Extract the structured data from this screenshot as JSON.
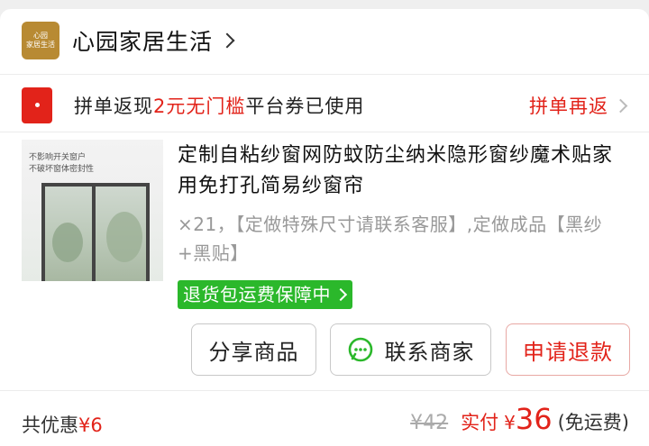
{
  "store": {
    "logo_line1": "心园",
    "logo_line2": "家居生活",
    "name": "心园家居生活"
  },
  "coupon": {
    "prefix": "拼单返现",
    "highlight": "2元无门槛",
    "suffix": "平台券已使用",
    "action": "拼单再返"
  },
  "product": {
    "thumb_caption_1": "不影响开关窗户",
    "thumb_caption_2": "不破坏窗体密封性",
    "title": "定制自粘纱窗网防蚊防尘纳米隐形窗纱魔术贴家用免打孔简易纱窗帘",
    "spec": "×21，【定做特殊尺寸请联系客服】,定做成品【黑纱+黑贴】",
    "tag": "退货包运费保障中"
  },
  "actions": {
    "share": "分享商品",
    "contact": "联系商家",
    "refund": "申请退款"
  },
  "footer": {
    "discount_label": "共优惠",
    "discount_value": "¥6",
    "original_price": "¥42",
    "paid_label": "实付",
    "currency": "¥",
    "paid_value": "36",
    "shipping": "(免运费)"
  },
  "colors": {
    "accent_red": "#e2231a",
    "tag_green": "#2bb82b",
    "logo_gold": "#b88a33"
  },
  "icons": [
    "chevron-right-icon",
    "coupon-icon",
    "chat-icon"
  ]
}
